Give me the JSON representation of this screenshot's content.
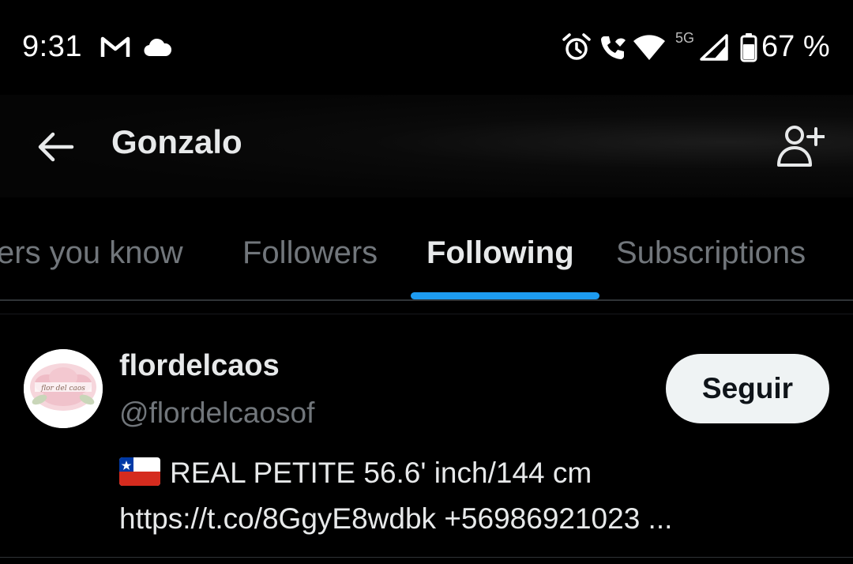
{
  "status_bar": {
    "time": "9:31",
    "network": "5G",
    "battery_percent": "67 %",
    "icons": [
      "gmail-icon",
      "cloud-icon",
      "alarm-icon",
      "wifi-call-icon",
      "wifi-icon",
      "signal-icon",
      "battery-icon"
    ]
  },
  "header": {
    "title": "Gonzalo",
    "back_icon": "arrow-left-icon",
    "add_icon": "person-add-icon"
  },
  "tabs": [
    {
      "label": "Followers you know",
      "visible_text": "ers you know",
      "active": false
    },
    {
      "label": "Followers",
      "visible_text": "Followers",
      "active": false
    },
    {
      "label": "Following",
      "visible_text": "Following",
      "active": true
    },
    {
      "label": "Subscriptions",
      "visible_text": "Subscriptions",
      "active": false
    }
  ],
  "users": [
    {
      "display_name": "flordelcaos",
      "handle": "@flordelcaosof",
      "follow_label": "Seguir",
      "bio_line1": "REAL PETITE 56.6' inch/144 cm",
      "bio_line2": "https://t.co/8GgyE8wdbk +56986921023 ...",
      "avatar_text": "flor del caos"
    }
  ],
  "colors": {
    "background": "#000000",
    "accent": "#1d9bf0",
    "text_primary": "#e7e9ea",
    "text_secondary": "#71767b",
    "follow_button_bg": "#eff3f4"
  }
}
